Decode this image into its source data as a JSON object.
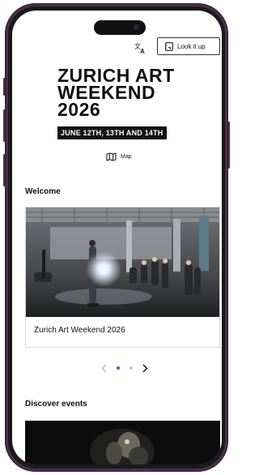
{
  "header": {
    "translate_icon": "translate-icon",
    "lookup_label": "Look it up",
    "lookup_icon": "lookup-icon"
  },
  "hero": {
    "title_lines": [
      "ZURICH ART",
      "WEEKEND",
      "2026"
    ],
    "dates": "JUNE 12TH, 13TH AND 14TH",
    "map_label": "Map",
    "map_icon": "map-icon"
  },
  "welcome": {
    "heading": "Welcome",
    "card_caption": "Zurich Art Weekend 2026",
    "carousel": {
      "active_index": 0,
      "count": 2
    }
  },
  "discover": {
    "heading": "Discover events"
  },
  "colors": {
    "frame": "#4a2f47",
    "text": "#111111",
    "active_dot": "#3a5bd0",
    "inactive": "#b8bdd6"
  }
}
